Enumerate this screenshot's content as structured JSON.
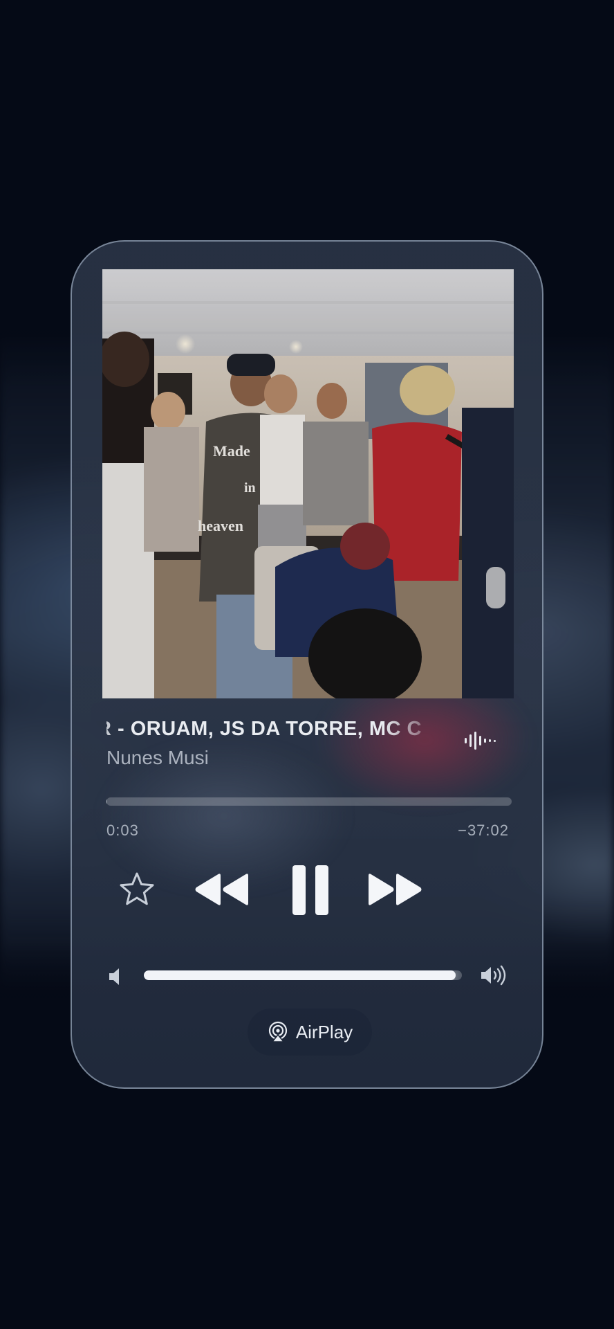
{
  "now_playing": {
    "title": "R - ORUAM, JS DA TORRE, MC C",
    "artist": "Nunes Musi",
    "elapsed": "0:03",
    "remaining": "−37:02",
    "progress_fraction": 0.0015,
    "artwork_text": {
      "line1": "Made",
      "line2": "in",
      "line3": "heaven"
    }
  },
  "controls": {
    "favorite_icon": "star-outline-icon",
    "rewind_icon": "backward-icon",
    "pause_icon": "pause-icon",
    "forward_icon": "forward-icon",
    "waveform_icon": "audio-waveform-icon"
  },
  "volume": {
    "level_fraction": 0.98,
    "low_icon": "speaker-low-icon",
    "high_icon": "speaker-high-icon"
  },
  "airplay": {
    "label": "AirPlay",
    "icon": "airplay-icon"
  },
  "colors": {
    "background": "#050a16",
    "card": "#2c3648",
    "card_border": "#b8c6d8",
    "text_primary": "#e9ecf1",
    "text_secondary": "#c9d0da"
  }
}
